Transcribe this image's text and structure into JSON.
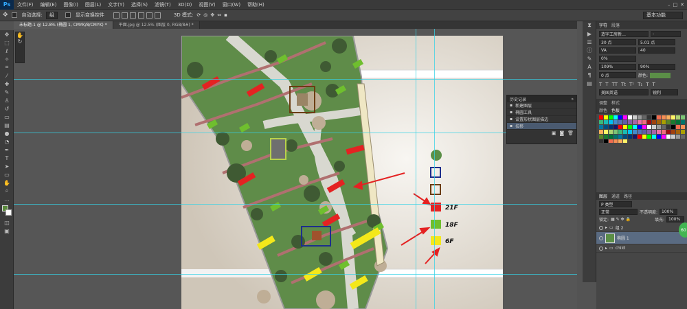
{
  "app": {
    "logo": "Ps",
    "workspace": "基本功能"
  },
  "menu": [
    "文件(F)",
    "编辑(E)",
    "图像(I)",
    "图层(L)",
    "文字(Y)",
    "选择(S)",
    "滤镜(T)",
    "3D(D)",
    "视图(V)",
    "窗口(W)",
    "帮助(H)"
  ],
  "options": {
    "auto_select_label": "自动选择:",
    "auto_select_value": "组",
    "show_transform_label": "显示变换控件",
    "mode3d_label": "3D 模式:"
  },
  "tabs": [
    {
      "label": "未标题-1 @ 12.8% (椭圆 1, CMYK/8/CMYK) *",
      "active": true
    },
    {
      "label": "平面.jpg @ 12.5% (图层 0, RGB/8#) *",
      "active": false
    }
  ],
  "history": {
    "tabs": [
      "历史记录",
      ""
    ],
    "items": [
      "新建图层",
      "椭圆工具",
      "设置形状图层描边",
      "拉移"
    ],
    "selected": 3
  },
  "legend": {
    "labels": [
      "21F",
      "18F",
      "6F"
    ],
    "colors": {
      "green": "#5b8f47",
      "blue": "#1d2e8c",
      "brown": "#6b3d12",
      "red": "#e42222",
      "lightgreen": "#6fbf2e",
      "yellow": "#f4e81a"
    }
  },
  "char_panel": {
    "tabs": [
      "字符",
      "段落"
    ],
    "font": "造字工房新…",
    "size": "30 点",
    "leading": "5.01 点",
    "tracking": "40",
    "kern": "0%",
    "vscale": "109%",
    "hscale": "90%",
    "baseline": "0 点",
    "color_label": "颜色:",
    "lang": "美国英语",
    "aa": "锐利"
  },
  "swatches_tabs": [
    "调整",
    "样式"
  ],
  "swatch_tabs2": [
    "颜色",
    "色板"
  ],
  "layers": {
    "tabs": [
      "图层",
      "通道",
      "路径"
    ],
    "kind": "P 类型",
    "blend": "正常",
    "opacity_label": "不透明度:",
    "opacity": "100%",
    "lock_label": "锁定:",
    "fill_label": "填充:",
    "fill": "100%",
    "rows": [
      "组 2",
      "椭圆 1",
      "child"
    ],
    "selected": 1
  },
  "badge": "60"
}
